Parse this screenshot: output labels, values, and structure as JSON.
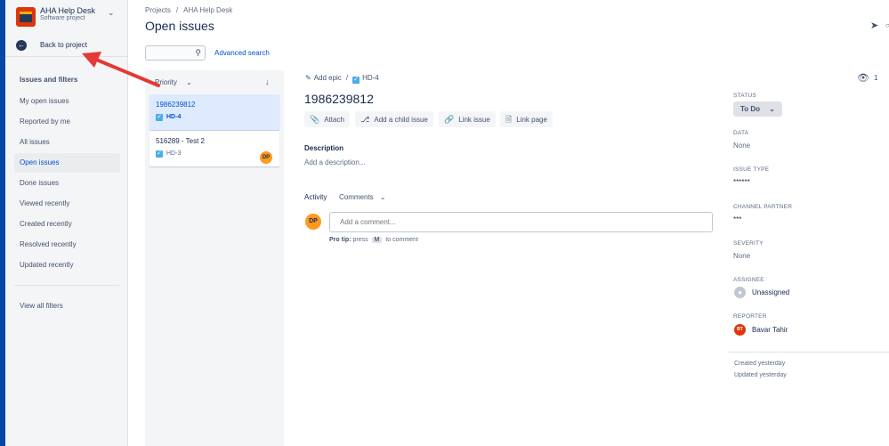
{
  "project": {
    "name": "AHA Help Desk",
    "type": "Software project",
    "back_label": "Back to project"
  },
  "sidebar": {
    "section_title": "Issues and filters",
    "items": [
      {
        "label": "My open issues"
      },
      {
        "label": "Reported by me"
      },
      {
        "label": "All issues"
      },
      {
        "label": "Open issues",
        "active": true
      },
      {
        "label": "Done issues"
      },
      {
        "label": "Viewed recently"
      },
      {
        "label": "Created recently"
      },
      {
        "label": "Resolved recently"
      },
      {
        "label": "Updated recently"
      }
    ],
    "view_all": "View all filters"
  },
  "header": {
    "breadcrumb": [
      "Projects",
      "/",
      "AHA Help Desk"
    ],
    "title": "Open issues",
    "advanced_search": "Advanced search",
    "search_value": ""
  },
  "list": {
    "sort_label": "Priority",
    "issues": [
      {
        "title": "1986239812",
        "key": "HD-4",
        "selected": true
      },
      {
        "title": "516289 - Test 2",
        "key": "HD-3",
        "avatar": "DP"
      }
    ]
  },
  "detail": {
    "add_epic": "Add epic",
    "key": "HD-4",
    "watchers": "1",
    "title": "1986239812",
    "actions": {
      "attach": "Attach",
      "child": "Add a child issue",
      "link_issue": "Link issue",
      "link_page": "Link page"
    },
    "description_label": "Description",
    "description_placeholder": "Add a description...",
    "activity_label": "Activity",
    "comments_label": "Comments",
    "commenter_initials": "DP",
    "comment_placeholder": "Add a comment...",
    "pro_tip_label": "Pro tip:",
    "pro_tip_press": "press",
    "pro_tip_key": "M",
    "pro_tip_rest": "to comment"
  },
  "fields": {
    "status_label": "STATUS",
    "status_value": "To Do",
    "data_label": "DATA",
    "data_value": "None",
    "issue_type_label": "ISSUE TYPE",
    "issue_type_value": "******",
    "channel_label": "CHANNEL PARTNER",
    "channel_value": "***",
    "severity_label": "SEVERITY",
    "severity_value": "None",
    "assignee_label": "ASSIGNEE",
    "assignee_value": "Unassigned",
    "reporter_label": "REPORTER",
    "reporter_value": "Bavar Tahir",
    "reporter_initials": "BT",
    "created": "Created yesterday",
    "updated": "Updated yesterday"
  },
  "colors": {
    "accent": "#0052cc",
    "annotation_arrow": "#e53935",
    "avatar_dp": "#ff991f",
    "avatar_bt": "#de350b"
  }
}
